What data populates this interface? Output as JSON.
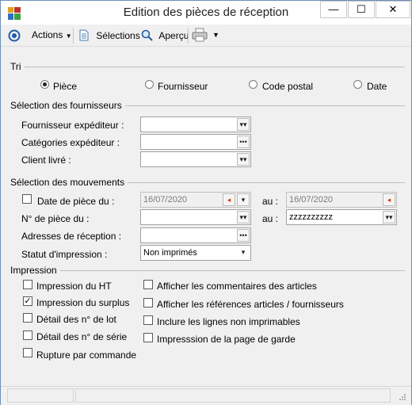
{
  "window": {
    "title": "Edition des pièces de réception",
    "minimize": "—",
    "maximize": "☐",
    "close": "✕"
  },
  "toolbar": {
    "actions": "Actions",
    "selections": "Sélections",
    "apercu": "Aperçu"
  },
  "tri": {
    "label": "Tri",
    "options": [
      {
        "label": "Pièce",
        "selected": true
      },
      {
        "label": "Fournisseur",
        "selected": false
      },
      {
        "label": "Code postal",
        "selected": false
      },
      {
        "label": "Date",
        "selected": false
      }
    ]
  },
  "fournisseurs": {
    "label": "Sélection des fournisseurs",
    "fournisseur_expediteur": {
      "label": "Fournisseur expéditeur :",
      "value": ""
    },
    "categories_expediteur": {
      "label": "Catégories expéditeur :",
      "value": ""
    },
    "client_livre": {
      "label": "Client livré :",
      "value": ""
    }
  },
  "mouvements": {
    "label": "Sélection des mouvements",
    "date_piece": {
      "label": "Date de pièce du :",
      "checked": false,
      "from": "16/07/2020",
      "to_label": "au :",
      "to": "16/07/2020"
    },
    "num_piece": {
      "label": "N° de pièce du :",
      "from": "",
      "to_label": "au :",
      "to": "zzzzzzzzzz"
    },
    "adresses": {
      "label": "Adresses de réception :",
      "value": ""
    },
    "statut": {
      "label": "Statut d'impression :",
      "value": "Non imprimés"
    }
  },
  "impression": {
    "label": "Impression",
    "left": [
      {
        "label": "Impression du HT",
        "checked": false
      },
      {
        "label": "Impression du surplus",
        "checked": true
      },
      {
        "label": "Détail des n° de lot",
        "checked": false
      },
      {
        "label": "Détail des n° de série",
        "checked": false
      },
      {
        "label": "Rupture par commande",
        "checked": false
      }
    ],
    "right": [
      {
        "label": "Afficher les commentaires des articles",
        "checked": false
      },
      {
        "label": "Afficher les références articles / fournisseurs",
        "checked": false
      },
      {
        "label": "Inclure les lignes non imprimables",
        "checked": false
      },
      {
        "label": "Impresssion de la page de garde",
        "checked": false
      }
    ]
  },
  "colors": {
    "accent": "#1e5aa8",
    "border": "#6b8fb5",
    "background": "#f0f0f0"
  }
}
